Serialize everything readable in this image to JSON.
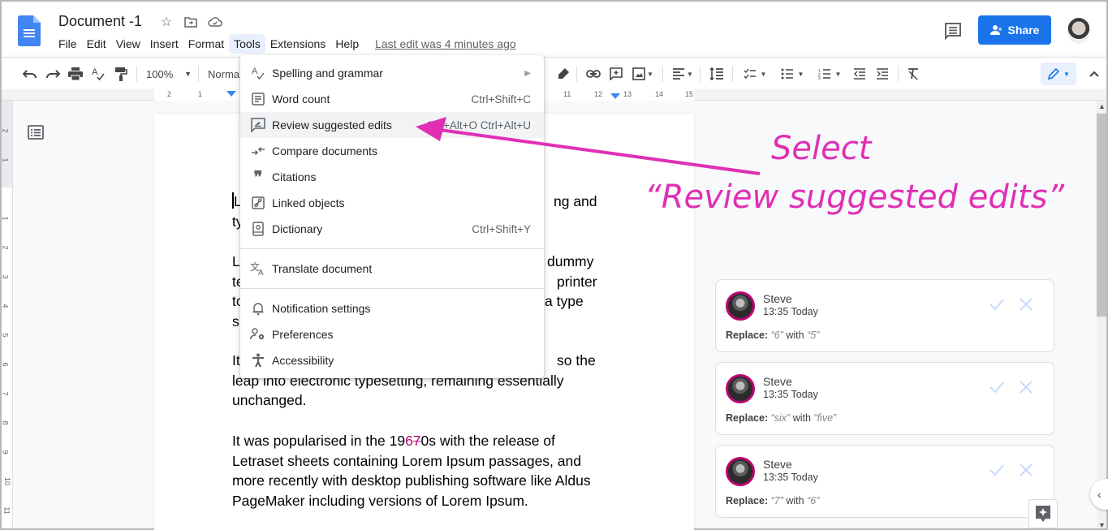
{
  "header": {
    "doc_title": "Document -1",
    "menu": [
      "File",
      "Edit",
      "View",
      "Insert",
      "Format",
      "Tools",
      "Extensions",
      "Help"
    ],
    "active_menu": "Tools",
    "last_edit": "Last edit was 4 minutes ago",
    "share_label": "Share"
  },
  "toolbar": {
    "zoom": "100%",
    "style": "Normal"
  },
  "ruler": {
    "horizontal": [
      "2",
      "1",
      "11",
      "12",
      "13",
      "14",
      "15"
    ],
    "vertical": [
      "2",
      "1",
      "1",
      "2",
      "3",
      "4",
      "5",
      "6",
      "7",
      "8",
      "9",
      "10",
      "11"
    ]
  },
  "tools_menu": {
    "items": [
      {
        "icon": "spellcheck-icon",
        "label": "Spelling and grammar",
        "shortcut": "",
        "submenu": true
      },
      {
        "icon": "word-count-icon",
        "label": "Word count",
        "shortcut": "Ctrl+Shift+C"
      },
      {
        "icon": "review-edits-icon",
        "label": "Review suggested edits",
        "shortcut": "Ctrl+Alt+O Ctrl+Alt+U",
        "highlighted": true
      },
      {
        "icon": "compare-icon",
        "label": "Compare documents",
        "shortcut": ""
      },
      {
        "icon": "quote-icon",
        "label": "Citations",
        "shortcut": ""
      },
      {
        "icon": "linked-objects-icon",
        "label": "Linked objects",
        "shortcut": ""
      },
      {
        "icon": "dictionary-icon",
        "label": "Dictionary",
        "shortcut": "Ctrl+Shift+Y"
      },
      {
        "icon": "translate-icon",
        "label": "Translate document",
        "shortcut": ""
      },
      {
        "icon": "bell-icon",
        "label": "Notification settings",
        "shortcut": ""
      },
      {
        "icon": "preferences-icon",
        "label": "Preferences",
        "shortcut": ""
      },
      {
        "icon": "accessibility-icon",
        "label": "Accessibility",
        "shortcut": ""
      }
    ]
  },
  "document": {
    "p1_line1_left": "L",
    "p1_line1_right": "ng and",
    "p1_line2_left": "ty",
    "p2_lines_left": [
      "L",
      "te",
      "to",
      "s"
    ],
    "p2_lines_right": [
      "dummy",
      "printer",
      "a type",
      ""
    ],
    "p3_line1_left": "It",
    "p3_line1_right": "so the",
    "p3_line2": "leap into electronic typesetting, remaining essentially",
    "p3_line3": "unchanged.",
    "p4_pre": "It was popularised in the 19",
    "p4_insert": "6",
    "p4_delete": "7",
    "p4_post": "0s with the release of",
    "p4_line2": "Letraset sheets containing Lorem Ipsum passages, and",
    "p4_line3": "more recently with desktop publishing software like Aldus",
    "p4_line4": "PageMaker including versions of Lorem Ipsum."
  },
  "annotation": {
    "line1": "Select",
    "line2": "“Review suggested edits”",
    "color": "#e02fb5"
  },
  "suggestions": [
    {
      "author": "Steve",
      "time": "13:35 Today",
      "action": "Replace:",
      "from": "“6”",
      "with": "with",
      "to": "“5”"
    },
    {
      "author": "Steve",
      "time": "13:35 Today",
      "action": "Replace:",
      "from": "“six”",
      "with": "with",
      "to": "“five”"
    },
    {
      "author": "Steve",
      "time": "13:35 Today",
      "action": "Replace:",
      "from": "“7”",
      "with": "with",
      "to": "“6”"
    }
  ],
  "colors": {
    "share": "#1a73e8",
    "suggestion": "#b80672"
  }
}
